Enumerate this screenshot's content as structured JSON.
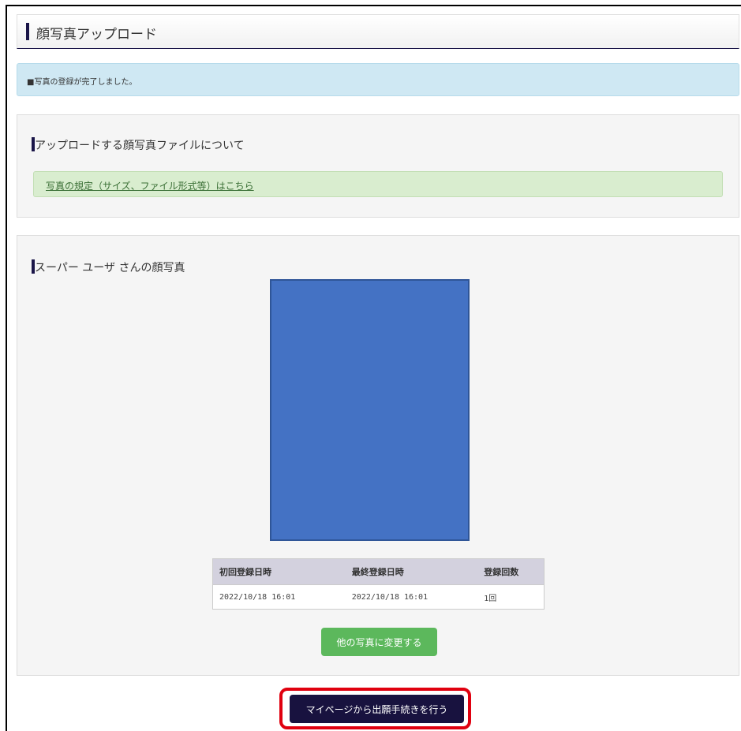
{
  "page": {
    "title": "顔写真アップロード"
  },
  "alert": {
    "message": "■写真の登録が完了しました。"
  },
  "about_section": {
    "title": "アップロードする顔写真ファイルについて",
    "link_text": "写真の規定（サイズ、ファイル形式等）はこちら"
  },
  "photo_section": {
    "title": "スーパー ユーザ さんの顔写真",
    "photo_color": "#4472c4",
    "table": {
      "headers": [
        "初回登録日時",
        "最終登録日時",
        "登録回数"
      ],
      "rows": [
        [
          "2022/10/18 16:01",
          "2022/10/18 16:01",
          "1回"
        ]
      ]
    },
    "change_button": "他の写真に変更する"
  },
  "proceed_button": "マイページから出願手続きを行う",
  "colors": {
    "navy": "#1a1548",
    "success_green": "#5cb85c",
    "info_blue": "#cfe8f3",
    "highlight_red": "#e0000f"
  }
}
